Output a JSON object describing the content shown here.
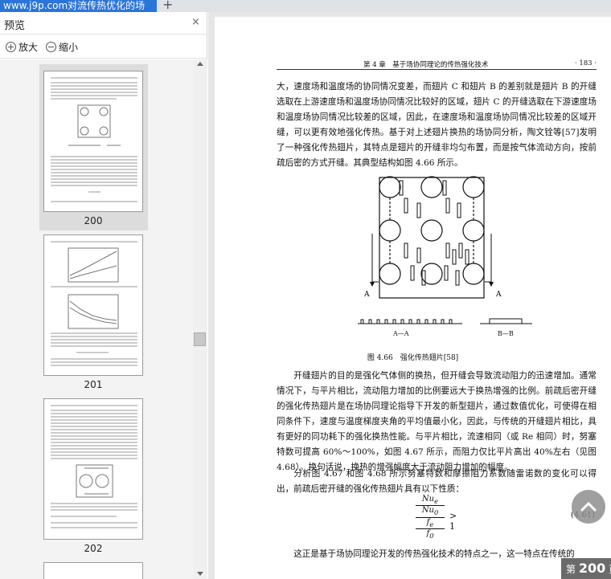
{
  "tab": {
    "title": "www.j9p.com对流传热优化的场",
    "add_label": "+"
  },
  "sidebar": {
    "title": "预览",
    "close_label": "×",
    "zoom_in_label": "放大",
    "zoom_out_label": "缩小",
    "thumbnails": [
      {
        "page": "200",
        "selected": true
      },
      {
        "page": "201",
        "selected": false
      },
      {
        "page": "202",
        "selected": false
      }
    ]
  },
  "document": {
    "header_left": "第 4 章　基于场协同理论的传热强化技术",
    "header_page": "· 183 ·",
    "para1": "大，速度场和温度场的协同情况变差，而翅片 C 和翅片 B 的差别就是翅片 B 的开缝选取在上游速度场和温度场协同情况比较好的区域，翅片 C 的开缝选取在下游速度场和温度场协同情况比较差的区域，因此，在速度场和温度场协同情况比较差的区域开缝，可以更有效地强化传热。基于对上述翅片换热的场协同分析，陶文铨等[57]发明了一种强化传热翅片，其特点是翅片的开缝非均匀布置，而是按气体流动方向，按前疏后密的方式开缝。其典型结构如图 4.66 所示。",
    "figure_label_a1": "A",
    "figure_label_a2": "A",
    "figure_label_aa": "A—A",
    "figure_label_bb": "B—B",
    "figure_caption": "图 4.66　强化传热翅片[58]",
    "para2": "开缝翅片的目的是强化气体侧的换热，但开缝会导致流动阻力的迅速增加。通常情况下，与平片相比，流动阻力增加的比例要远大于换热增强的比例。前疏后密开缝的强化传热翅片是在场协同理论指导下开发的新型翅片，通过数值优化，可使得在相同条件下，速度与温度梯度夹角的平均值最小化，因此，与传统的开缝翅片相比，具有更好的同功耗下的强化换热性能。与平片相比，流速相同（或 Re 相同）时，努塞特数可提高 60%～100%，如图 4.67 所示，而阻力仅比平片高出 40%左右（见图 4.68）。换句话说，换热的增强幅度大于流动阻力增加的幅度。",
    "para3": "分析图 4.67 和图 4.68 所示努塞特数和摩擦阻力系数随雷诺数的变化可以得出，前疏后密开缝的强化传热翅片具有以下性质：",
    "formula_num_top": "Nu",
    "formula_num_top_sub": "e",
    "formula_num_bot": "Nu",
    "formula_num_bot_sub": "0",
    "formula_den_top": "f",
    "formula_den_top_sub": "e",
    "formula_den_bot": "f",
    "formula_den_bot_sub": "0",
    "formula_rel": "> 1",
    "formula_number": "(4.61)",
    "para4": "这正是基于场协同理论开发的传热强化技术的特点之一，这一特点在传统的"
  },
  "page_badge": {
    "prefix": "第",
    "number": "200",
    "suffix": "页"
  }
}
